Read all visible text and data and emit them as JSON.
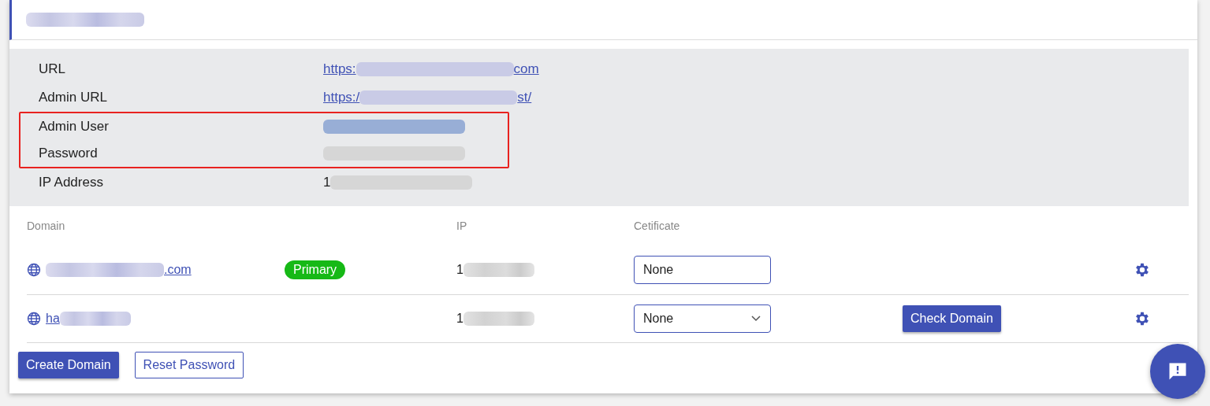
{
  "details": [
    {
      "label": "URL",
      "value": {
        "prefix": "https:",
        "suffix": "com",
        "link": true,
        "color": "#c9cbe6"
      },
      "highlighted": false
    },
    {
      "label": "Admin URL",
      "value": {
        "prefix": "https:/",
        "suffix": "st/",
        "link": true,
        "color": "#c9cbe6"
      },
      "highlighted": false
    },
    {
      "label": "Admin User",
      "value": {
        "color": "#98aed6"
      },
      "highlighted": true
    },
    {
      "label": "Password",
      "value": {
        "color": "#d6d6d6"
      },
      "highlighted": true
    },
    {
      "label": "IP Address",
      "value": {
        "prefix": "1",
        "link": false,
        "color": "#d6d6d6"
      },
      "highlighted": false
    }
  ],
  "domains": {
    "columns": [
      "Domain",
      "",
      "IP",
      "Cetificate"
    ],
    "rows": [
      {
        "domain_suffix": ".com",
        "badge": "Primary",
        "ip_prefix": "1",
        "certificate": {
          "value": "None",
          "dropdown": false
        }
      },
      {
        "domain_prefix": "ha",
        "ip_prefix": "1",
        "certificate": {
          "value": "None",
          "dropdown": true
        },
        "action": "Check Domain"
      }
    ]
  },
  "buttons": [
    {
      "label": "Create Domain",
      "kind": "primary"
    },
    {
      "label": "Reset Password",
      "kind": "outline"
    }
  ]
}
